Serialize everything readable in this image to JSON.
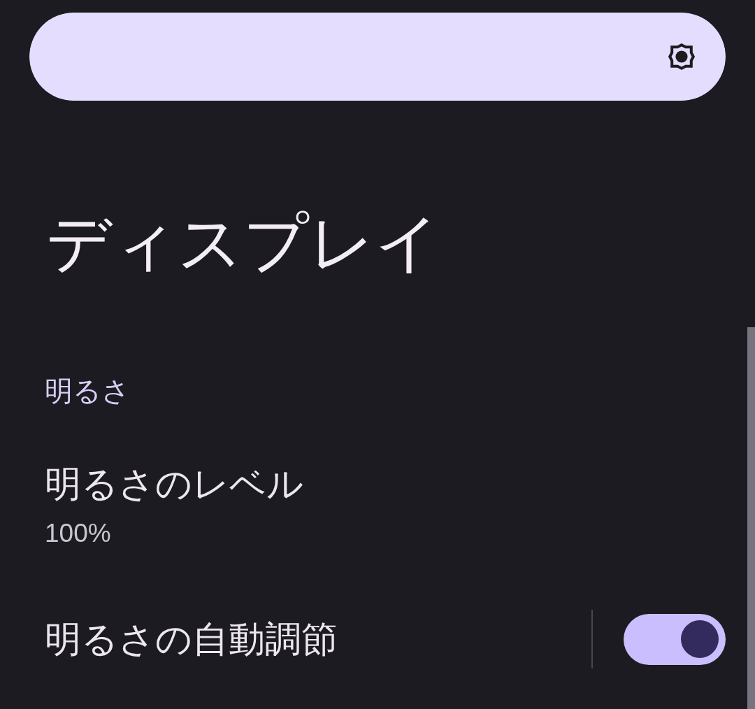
{
  "brightness_slider": {
    "level": 1
  },
  "title": "ディスプレイ",
  "section": {
    "header": "明るさ",
    "items": [
      {
        "kind": "summary",
        "title": "明るさのレベル",
        "summary": "100%"
      },
      {
        "kind": "switch",
        "title": "明るさの自動調節",
        "on": true
      }
    ]
  }
}
